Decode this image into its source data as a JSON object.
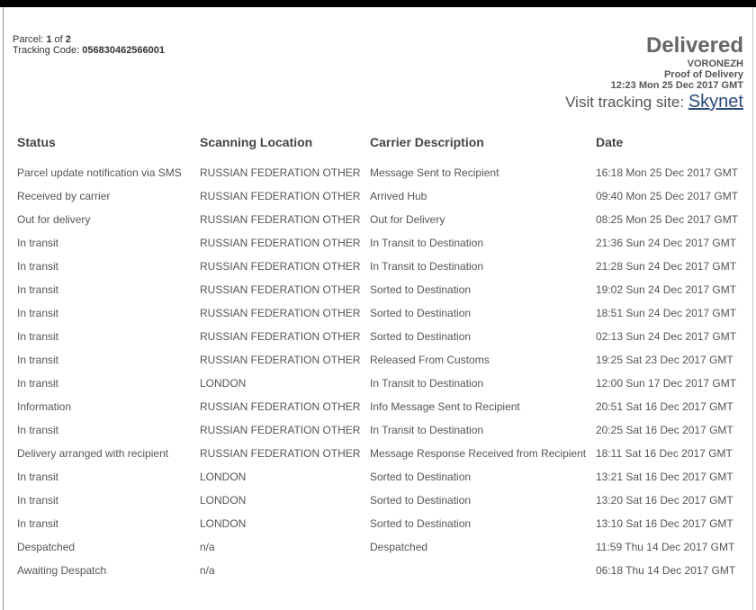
{
  "parcel": {
    "label": "Parcel:",
    "current": "1",
    "of": "of",
    "total": "2",
    "tracking_label": "Tracking Code:",
    "tracking_code": "056830462566001"
  },
  "summary": {
    "status": "Delivered",
    "location": "VORONEZH",
    "proof": "Proof of Delivery",
    "datetime": "12:23 Mon 25 Dec 2017 GMT",
    "visit_label": "Visit tracking site:",
    "site_link": "Skynet"
  },
  "table": {
    "headers": [
      "Status",
      "Scanning Location",
      "Carrier Description",
      "Date"
    ],
    "rows": [
      [
        "Parcel update notification via SMS",
        "RUSSIAN FEDERATION OTHER",
        "Message Sent to Recipient",
        "16:18 Mon 25 Dec 2017 GMT"
      ],
      [
        "Received by carrier",
        "RUSSIAN FEDERATION OTHER",
        "Arrived Hub",
        "09:40 Mon 25 Dec 2017 GMT"
      ],
      [
        "Out for delivery",
        "RUSSIAN FEDERATION OTHER",
        "Out for Delivery",
        "08:25 Mon 25 Dec 2017 GMT"
      ],
      [
        "In transit",
        "RUSSIAN FEDERATION OTHER",
        "In Transit to Destination",
        "21:36 Sun 24 Dec 2017 GMT"
      ],
      [
        "In transit",
        "RUSSIAN FEDERATION OTHER",
        "In Transit to Destination",
        "21:28 Sun 24 Dec 2017 GMT"
      ],
      [
        "In transit",
        "RUSSIAN FEDERATION OTHER",
        "Sorted to Destination",
        "19:02 Sun 24 Dec 2017 GMT"
      ],
      [
        "In transit",
        "RUSSIAN FEDERATION OTHER",
        "Sorted to Destination",
        "18:51 Sun 24 Dec 2017 GMT"
      ],
      [
        "In transit",
        "RUSSIAN FEDERATION OTHER",
        "Sorted to Destination",
        "02:13 Sun 24 Dec 2017 GMT"
      ],
      [
        "In transit",
        "RUSSIAN FEDERATION OTHER",
        "Released From Customs",
        "19:25 Sat 23 Dec 2017 GMT"
      ],
      [
        "In transit",
        "LONDON",
        "In Transit to Destination",
        "12:00 Sun 17 Dec 2017 GMT"
      ],
      [
        "Information",
        "RUSSIAN FEDERATION OTHER",
        "Info Message Sent to Recipient",
        "20:51 Sat 16 Dec 2017 GMT"
      ],
      [
        "In transit",
        "RUSSIAN FEDERATION OTHER",
        "In Transit to Destination",
        "20:25 Sat 16 Dec 2017 GMT"
      ],
      [
        "Delivery arranged with recipient",
        "RUSSIAN FEDERATION OTHER",
        "Message Response Received from Recipient",
        "18:11 Sat 16 Dec 2017 GMT"
      ],
      [
        "In transit",
        "LONDON",
        "Sorted to Destination",
        "13:21 Sat 16 Dec 2017 GMT"
      ],
      [
        "In transit",
        "LONDON",
        "Sorted to Destination",
        "13:20 Sat 16 Dec 2017 GMT"
      ],
      [
        "In transit",
        "LONDON",
        "Sorted to Destination",
        "13:10 Sat 16 Dec 2017 GMT"
      ],
      [
        "Despatched",
        "n/a",
        "Despatched",
        "11:59 Thu 14 Dec 2017 GMT"
      ],
      [
        "Awaiting Despatch",
        "n/a",
        "",
        "06:18 Thu 14 Dec 2017 GMT"
      ]
    ]
  }
}
